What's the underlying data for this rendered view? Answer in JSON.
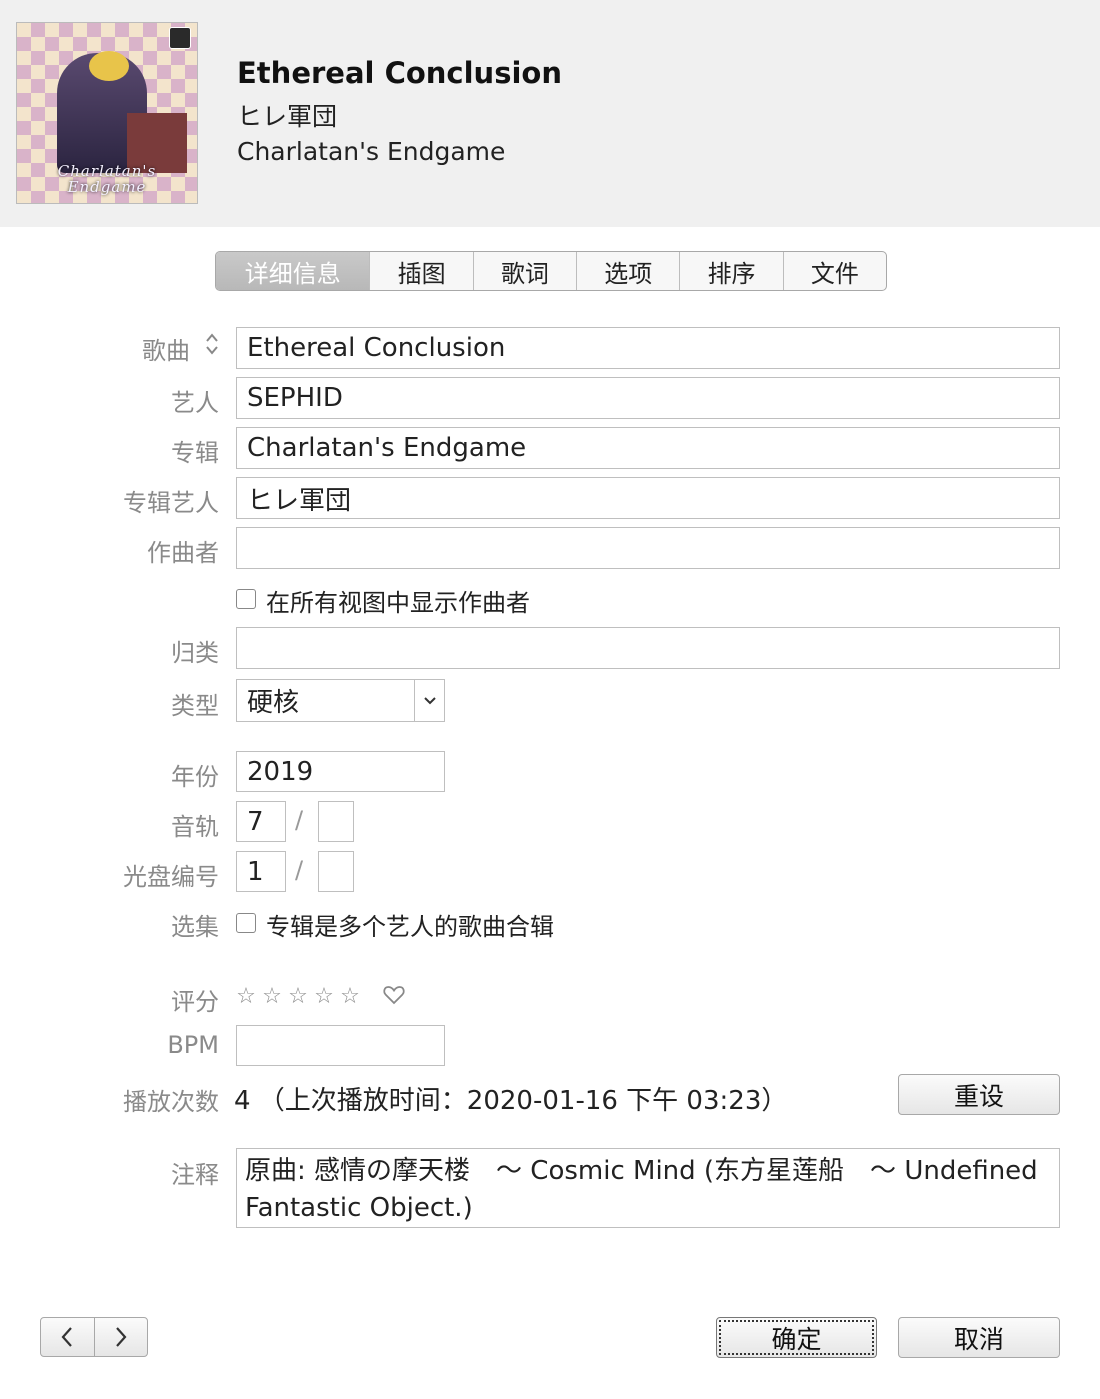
{
  "header": {
    "title": "Ethereal Conclusion",
    "album_artist": "ヒレ軍団",
    "album": "Charlatan's Endgame",
    "artwork_text": "Charlatan's Endgame"
  },
  "tabs": [
    "详细信息",
    "插图",
    "歌词",
    "选项",
    "排序",
    "文件"
  ],
  "form": {
    "song_label": "歌曲",
    "song_value": "Ethereal Conclusion",
    "artist_label": "艺人",
    "artist_value": "SEPHID",
    "album_label": "专辑",
    "album_value": "Charlatan's Endgame",
    "album_artist_label": "专辑艺人",
    "album_artist_value": "ヒレ軍団",
    "composer_label": "作曲者",
    "composer_value": "",
    "show_composer_label": "在所有视图中显示作曲者",
    "grouping_label": "归类",
    "grouping_value": "",
    "genre_label": "类型",
    "genre_value": "硬核",
    "year_label": "年份",
    "year_value": "2019",
    "track_label": "音轨",
    "track_value": "7",
    "track_total": "",
    "disc_label": "光盘编号",
    "disc_value": "1",
    "disc_total": "",
    "slash": "/",
    "compilation_label": "选集",
    "compilation_text": "专辑是多个艺人的歌曲合辑",
    "rating_label": "评分",
    "rating_stars": 0,
    "bpm_label": "BPM",
    "bpm_value": "",
    "plays_label": "播放次数",
    "plays_text": "4 （上次播放时间：2020-01-16 下午 03:23）",
    "reset_label": "重设",
    "comments_label": "注释",
    "comments_value": "原曲: 感情の摩天楼　～ Cosmic Mind (东方星莲船　～ Undefined Fantastic Object.)"
  },
  "footer": {
    "ok_label": "确定",
    "cancel_label": "取消"
  }
}
